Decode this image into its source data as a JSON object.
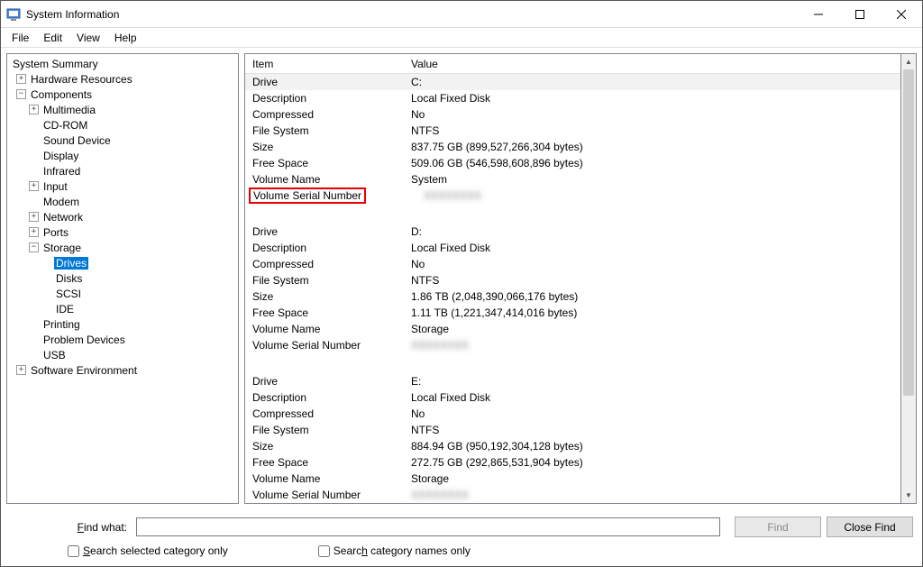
{
  "titlebar": {
    "title": "System Information"
  },
  "menubar": {
    "file": "File",
    "edit": "Edit",
    "view": "View",
    "help": "Help"
  },
  "tree": {
    "root": "System Summary",
    "hardware": "Hardware Resources",
    "components": "Components",
    "multimedia": "Multimedia",
    "cdrom": "CD-ROM",
    "sounddevice": "Sound Device",
    "display": "Display",
    "infrared": "Infrared",
    "input": "Input",
    "modem": "Modem",
    "network": "Network",
    "ports": "Ports",
    "storage": "Storage",
    "drives": "Drives",
    "disks": "Disks",
    "scsi": "SCSI",
    "ide": "IDE",
    "printing": "Printing",
    "problemdevices": "Problem Devices",
    "usb": "USB",
    "softwareenv": "Software Environment"
  },
  "columns": {
    "item": "Item",
    "value": "Value"
  },
  "drives": [
    {
      "drive_label": "Drive",
      "drive_value": "C:",
      "description_label": "Description",
      "description_value": "Local Fixed Disk",
      "compressed_label": "Compressed",
      "compressed_value": "No",
      "filesystem_label": "File System",
      "filesystem_value": "NTFS",
      "size_label": "Size",
      "size_value": "837.75 GB (899,527,266,304 bytes)",
      "freespace_label": "Free Space",
      "freespace_value": "509.06 GB (546,598,608,896 bytes)",
      "volumename_label": "Volume Name",
      "volumename_value": "System",
      "serial_label": "Volume Serial Number",
      "serial_value": "XXXXXXXX"
    },
    {
      "drive_label": "Drive",
      "drive_value": "D:",
      "description_label": "Description",
      "description_value": "Local Fixed Disk",
      "compressed_label": "Compressed",
      "compressed_value": "No",
      "filesystem_label": "File System",
      "filesystem_value": "NTFS",
      "size_label": "Size",
      "size_value": "1.86 TB (2,048,390,066,176 bytes)",
      "freespace_label": "Free Space",
      "freespace_value": "1.11 TB (1,221,347,414,016 bytes)",
      "volumename_label": "Volume Name",
      "volumename_value": "Storage",
      "serial_label": "Volume Serial Number",
      "serial_value": "XXXXXXXX"
    },
    {
      "drive_label": "Drive",
      "drive_value": "E:",
      "description_label": "Description",
      "description_value": "Local Fixed Disk",
      "compressed_label": "Compressed",
      "compressed_value": "No",
      "filesystem_label": "File System",
      "filesystem_value": "NTFS",
      "size_label": "Size",
      "size_value": "884.94 GB (950,192,304,128 bytes)",
      "freespace_label": "Free Space",
      "freespace_value": "272.75 GB (292,865,531,904 bytes)",
      "volumename_label": "Volume Name",
      "volumename_value": "Storage",
      "serial_label": "Volume Serial Number",
      "serial_value": "XXXXXXXX"
    }
  ],
  "find": {
    "label": "Find what:",
    "find_btn": "Find",
    "close_btn": "Close Find",
    "search_selected": "Search selected category only",
    "search_names": "Search category names only"
  }
}
